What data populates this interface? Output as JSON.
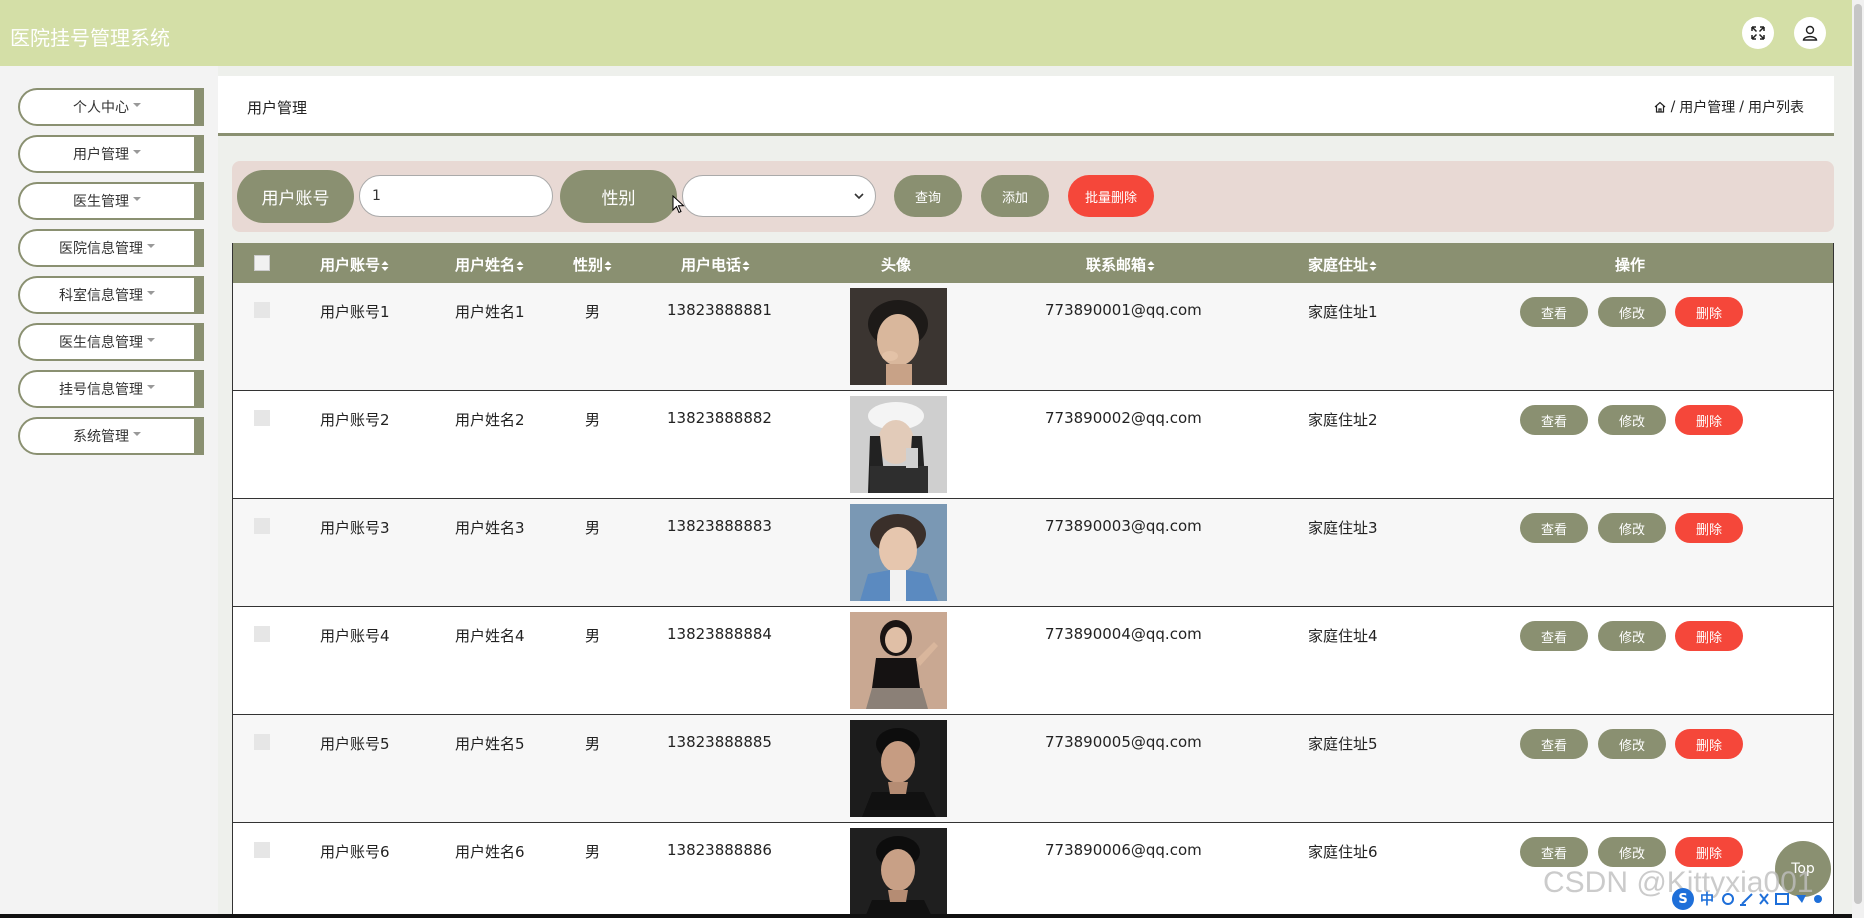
{
  "app": {
    "title": "医院挂号管理系统"
  },
  "header_icons": {
    "expand": "fullscreen-icon",
    "user": "user-icon"
  },
  "sidebar": {
    "items": [
      {
        "label": "个人中心"
      },
      {
        "label": "用户管理"
      },
      {
        "label": "医生管理"
      },
      {
        "label": "医院信息管理"
      },
      {
        "label": "科室信息管理"
      },
      {
        "label": "医生信息管理"
      },
      {
        "label": "挂号信息管理"
      },
      {
        "label": "系统管理"
      }
    ]
  },
  "breadcrumb": {
    "page_title": "用户管理",
    "home_icon": "home-icon",
    "sep": "/",
    "level1": "用户管理",
    "level2": "用户列表"
  },
  "search": {
    "account_label": "用户账号",
    "account_value": "1",
    "sex_label": "性别",
    "sex_selected": "",
    "query_label": "查询",
    "add_label": "添加",
    "batch_delete_label": "批量删除"
  },
  "table": {
    "columns": [
      "用户账号",
      "用户姓名",
      "性别",
      "用户电话",
      "头像",
      "联系邮箱",
      "家庭住址",
      "操作"
    ],
    "action_labels": {
      "view": "查看",
      "edit": "修改",
      "delete": "删除"
    },
    "rows": [
      {
        "account": "用户账号1",
        "name": "用户姓名1",
        "sex": "男",
        "phone": "13823888881",
        "email": "773890001@qq.com",
        "address": "家庭住址1"
      },
      {
        "account": "用户账号2",
        "name": "用户姓名2",
        "sex": "男",
        "phone": "13823888882",
        "email": "773890002@qq.com",
        "address": "家庭住址2"
      },
      {
        "account": "用户账号3",
        "name": "用户姓名3",
        "sex": "男",
        "phone": "13823888883",
        "email": "773890003@qq.com",
        "address": "家庭住址3"
      },
      {
        "account": "用户账号4",
        "name": "用户姓名4",
        "sex": "男",
        "phone": "13823888884",
        "email": "773890004@qq.com",
        "address": "家庭住址4"
      },
      {
        "account": "用户账号5",
        "name": "用户姓名5",
        "sex": "男",
        "phone": "13823888885",
        "email": "773890005@qq.com",
        "address": "家庭住址5"
      },
      {
        "account": "用户账号6",
        "name": "用户姓名6",
        "sex": "男",
        "phone": "13823888886",
        "email": "773890006@qq.com",
        "address": "家庭住址6"
      }
    ]
  },
  "floating": {
    "top_label": "Top"
  },
  "watermark": "CSDN @Kittyxia001",
  "ime": {
    "logo": "S",
    "lang": "中"
  },
  "colors": {
    "header": "#d4dfa7",
    "accent": "#8a9071",
    "danger": "#f5473a",
    "searchbar": "#e8d9d4"
  }
}
